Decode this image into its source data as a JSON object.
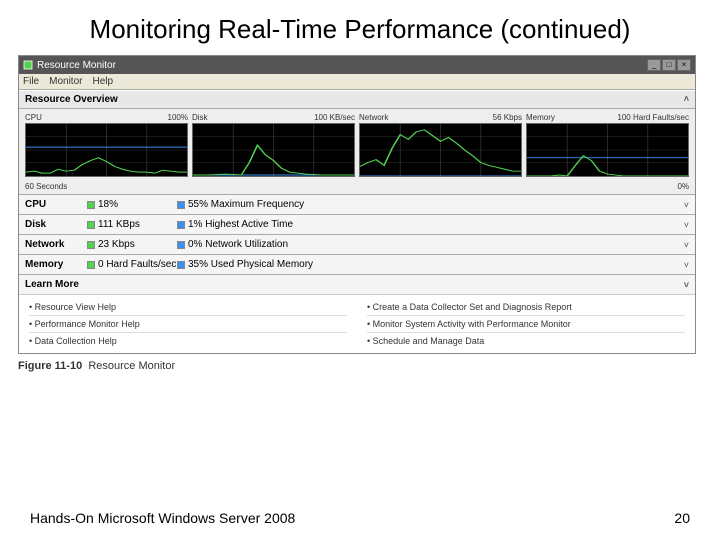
{
  "slide": {
    "title": "Monitoring Real-Time Performance (continued)"
  },
  "app": {
    "title": "Resource Monitor"
  },
  "menu": {
    "m0": "File",
    "m1": "Monitor",
    "m2": "Help"
  },
  "overview": {
    "label": "Resource Overview"
  },
  "graphs": {
    "g0": {
      "name": "CPU",
      "right": "100%"
    },
    "g1": {
      "name": "Disk",
      "right": "100 KB/sec"
    },
    "g2": {
      "name": "Network",
      "right": "56 Kbps"
    },
    "g3": {
      "name": "Memory",
      "right": "100 Hard Faults/sec"
    },
    "bottomLeft": "60 Seconds",
    "bottomRight": "0%"
  },
  "sections": {
    "s0": {
      "label": "CPU",
      "v1": "18%",
      "v2": "55% Maximum Frequency"
    },
    "s1": {
      "label": "Disk",
      "v1": "111 KBps",
      "v2": "1% Highest Active Time"
    },
    "s2": {
      "label": "Network",
      "v1": "23 Kbps",
      "v2": "0% Network Utilization"
    },
    "s3": {
      "label": "Memory",
      "v1": "0 Hard Faults/sec",
      "v2": "35% Used Physical Memory"
    }
  },
  "learn": {
    "label": "Learn More",
    "left": {
      "l0": "Resource View Help",
      "l1": "Performance Monitor Help",
      "l2": "Data Collection Help"
    },
    "right": {
      "r0": "Create a Data Collector Set and Diagnosis Report",
      "r1": "Monitor System Activity with Performance Monitor",
      "r2": "Schedule and Manage Data"
    }
  },
  "caption": {
    "num": "Figure 11-10",
    "text": "Resource Monitor"
  },
  "footer": {
    "left": "Hands-On Microsoft Windows Server 2008",
    "right": "20"
  },
  "chart_data": [
    {
      "type": "line",
      "title": "CPU",
      "xlabel": "60 Seconds",
      "ylabel": "%",
      "ylim": [
        0,
        100
      ],
      "series": [
        {
          "name": "usage",
          "values": [
            8,
            10,
            6,
            5,
            14,
            9,
            12,
            22,
            30,
            35,
            28,
            18,
            14,
            10,
            8,
            7,
            6,
            12,
            9,
            8
          ]
        },
        {
          "name": "max-frequency",
          "values": [
            55,
            55,
            55,
            55,
            55,
            55,
            55,
            55,
            55,
            55,
            55,
            55,
            55,
            55,
            55,
            55,
            55,
            55,
            55,
            55
          ]
        }
      ]
    },
    {
      "type": "line",
      "title": "Disk",
      "xlabel": "60 Seconds",
      "ylabel": "KB/sec",
      "ylim": [
        0,
        100
      ],
      "series": [
        {
          "name": "io",
          "values": [
            2,
            1,
            3,
            2,
            1,
            4,
            2,
            25,
            60,
            40,
            30,
            15,
            8,
            5,
            3,
            2,
            1,
            2,
            1,
            1
          ]
        },
        {
          "name": "active-time",
          "values": [
            1,
            1,
            1,
            1,
            1,
            1,
            1,
            1,
            1,
            1,
            1,
            1,
            1,
            1,
            1,
            1,
            1,
            1,
            1,
            1
          ]
        }
      ]
    },
    {
      "type": "line",
      "title": "Network",
      "xlabel": "60 Seconds",
      "ylabel": "Kbps",
      "ylim": [
        0,
        56
      ],
      "series": [
        {
          "name": "throughput",
          "values": [
            10,
            15,
            18,
            12,
            30,
            45,
            40,
            48,
            50,
            44,
            38,
            42,
            35,
            28,
            22,
            15,
            12,
            10,
            8,
            6
          ]
        },
        {
          "name": "utilization",
          "values": [
            0,
            0,
            0,
            0,
            0,
            0,
            0,
            0,
            0,
            0,
            0,
            0,
            0,
            0,
            0,
            0,
            0,
            0,
            0,
            0
          ]
        }
      ]
    },
    {
      "type": "line",
      "title": "Memory",
      "xlabel": "60 Seconds",
      "ylabel": "Hard Faults/sec",
      "ylim": [
        0,
        100
      ],
      "series": [
        {
          "name": "hard-faults",
          "values": [
            0,
            0,
            0,
            0,
            2,
            0,
            20,
            40,
            30,
            10,
            5,
            2,
            0,
            0,
            0,
            0,
            0,
            0,
            0,
            0
          ]
        },
        {
          "name": "used-physical",
          "values": [
            35,
            35,
            35,
            35,
            35,
            35,
            35,
            35,
            35,
            35,
            35,
            35,
            35,
            35,
            35,
            35,
            35,
            35,
            35,
            35
          ]
        }
      ]
    }
  ]
}
